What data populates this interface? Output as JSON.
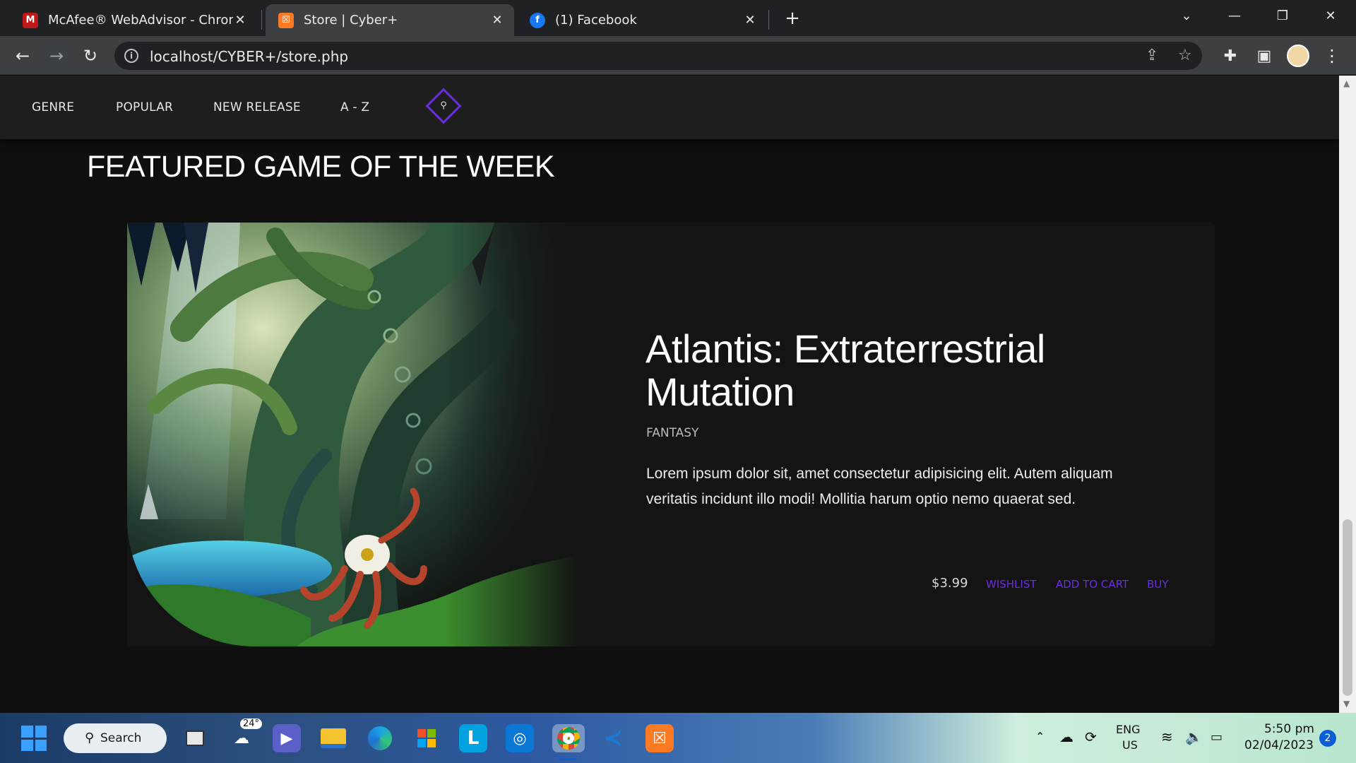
{
  "browser": {
    "tabs": [
      {
        "title": "McAfee® WebAdvisor - Chrome",
        "favicon": "mcafee-icon",
        "active": false
      },
      {
        "title": "Store | Cyber+",
        "favicon": "xampp-icon",
        "active": true
      },
      {
        "title": "(1) Facebook",
        "favicon": "facebook-icon",
        "active": false
      }
    ],
    "new_tab": "+",
    "close_glyph": "✕",
    "url": "localhost/CYBER+/store.php"
  },
  "nav": {
    "links": [
      "GENRE",
      "POPULAR",
      "NEW RELEASE",
      "A - Z"
    ]
  },
  "featured": {
    "heading": "FEATURED GAME OF THE WEEK",
    "game_title": "Atlantis: Extraterrestrial Mutation",
    "genre": "FANTASY",
    "description": "Lorem ipsum dolor sit, amet consectetur adipisicing elit. Autem aliquam veritatis incidunt illo modi! Mollitia harum optio nemo quaerat sed.",
    "price": "$3.99",
    "actions": [
      "WISHLIST",
      "ADD TO CART",
      "BUY"
    ],
    "accent_color": "#6a2ee0"
  },
  "taskbar": {
    "search_label": "Search",
    "weather": "24°",
    "lang_line1": "ENG",
    "lang_line2": "US",
    "time": "5:50 pm",
    "date": "02/04/2023",
    "notifications": "2"
  }
}
